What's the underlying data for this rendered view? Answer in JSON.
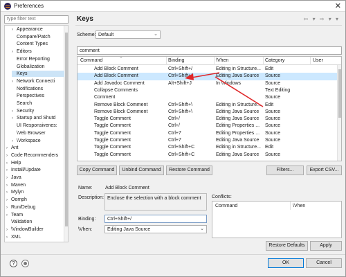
{
  "window": {
    "title": "Preferences",
    "close_glyph": "✕"
  },
  "filter": {
    "placeholder": "type filter text"
  },
  "tree": [
    {
      "label": "Appearance",
      "indent": 1,
      "arrow": "›"
    },
    {
      "label": "Compare/Patch",
      "indent": 1,
      "arrow": ""
    },
    {
      "label": "Content Types",
      "indent": 1,
      "arrow": ""
    },
    {
      "label": "Editors",
      "indent": 1,
      "arrow": "›"
    },
    {
      "label": "Error Reporting",
      "indent": 1,
      "arrow": ""
    },
    {
      "label": "Globalization",
      "indent": 1,
      "arrow": ""
    },
    {
      "label": "Keys",
      "indent": 1,
      "arrow": "",
      "selected": true
    },
    {
      "label": "Network Connecti",
      "indent": 1,
      "arrow": "›"
    },
    {
      "label": "Notifications",
      "indent": 1,
      "arrow": ""
    },
    {
      "label": "Perspectives",
      "indent": 1,
      "arrow": ""
    },
    {
      "label": "Search",
      "indent": 1,
      "arrow": ""
    },
    {
      "label": "Security",
      "indent": 1,
      "arrow": "›"
    },
    {
      "label": "Startup and Shutd",
      "indent": 1,
      "arrow": "›"
    },
    {
      "label": "UI Responsivenes:",
      "indent": 1,
      "arrow": ""
    },
    {
      "label": "\\Veb Browser",
      "indent": 1,
      "arrow": ""
    },
    {
      "label": "\\Vorkspace",
      "indent": 1,
      "arrow": "›"
    },
    {
      "label": "Ant",
      "indent": 0,
      "arrow": "›"
    },
    {
      "label": "Code Recommenders",
      "indent": 0,
      "arrow": "›"
    },
    {
      "label": "Help",
      "indent": 0,
      "arrow": "›"
    },
    {
      "label": "Install/Update",
      "indent": 0,
      "arrow": "›"
    },
    {
      "label": "Java",
      "indent": 0,
      "arrow": "›"
    },
    {
      "label": "Maven",
      "indent": 0,
      "arrow": "›"
    },
    {
      "label": "Mylyn",
      "indent": 0,
      "arrow": "›"
    },
    {
      "label": "Oomph",
      "indent": 0,
      "arrow": "›"
    },
    {
      "label": "Run/Debug",
      "indent": 0,
      "arrow": "›"
    },
    {
      "label": "Team",
      "indent": 0,
      "arrow": "›"
    },
    {
      "label": "Validation",
      "indent": 0,
      "arrow": ""
    },
    {
      "label": "\\VindowBuilder",
      "indent": 0,
      "arrow": "›"
    },
    {
      "label": "XML",
      "indent": 0,
      "arrow": "›"
    }
  ],
  "main": {
    "heading": "Keys",
    "nav_glyphs": "⇦ ▾ ⇨ ▾ ▾",
    "scheme_label": "Scheme:",
    "scheme_value": "Default",
    "search_value": "comment",
    "columns": [
      "Command",
      "Binding",
      "\\Vhen",
      "Category",
      "User"
    ],
    "rows": [
      [
        "Add Block Comment",
        "Ctrl+Shift+/",
        "Editing in Structure...",
        "Edit",
        ""
      ],
      [
        "Add Block Comment",
        "Ctrl+Shift+/",
        "Editing Java Source",
        "Source",
        ""
      ],
      [
        "Add Javadoc Comment",
        "Alt+Shift+J",
        "In \\Vindows",
        "Source",
        ""
      ],
      [
        "Collapse Comments",
        "",
        "",
        "Text Editing",
        ""
      ],
      [
        "Comment",
        "",
        "",
        "Source",
        ""
      ],
      [
        "Remove Block Comment",
        "Ctrl+Shift+\\",
        "Editing in Structure...",
        "Edit",
        ""
      ],
      [
        "Remove Block Comment",
        "Ctrl+Shift+\\",
        "Editing Java Source",
        "Source",
        ""
      ],
      [
        "Toggle Comment",
        "Ctrl+/",
        "Editing Java Source",
        "Source",
        ""
      ],
      [
        "Toggle Comment",
        "Ctrl+/",
        "Editing Properties ...",
        "Source",
        ""
      ],
      [
        "Toggle Comment",
        "Ctrl+7",
        "Editing Properties ...",
        "Source",
        ""
      ],
      [
        "Toggle Comment",
        "Ctrl+7",
        "Editing Java Source",
        "Source",
        ""
      ],
      [
        "Toggle Comment",
        "Ctrl+Shift+C",
        "Editing in Structure...",
        "Edit",
        ""
      ],
      [
        "Toggle Comment",
        "Ctrl+Shift+C",
        "Editing Java Source",
        "Source",
        ""
      ]
    ],
    "selected_row": 1,
    "buttons": {
      "copy": "Copy Command",
      "unbind": "Unbind Command",
      "restore": "Restore Command",
      "filters": "Filters...",
      "export": "Export CSV..."
    },
    "details": {
      "name_label": "Name:",
      "name_value": "Add Block Comment",
      "description_label": "Description:",
      "description_value": "Enclose the selection with a block comment",
      "binding_label": "Binding:",
      "binding_value": "Ctrl+Shift+/",
      "when_label": "\\Vhen:",
      "when_value": "Editing Java Source"
    },
    "conflicts": {
      "label": "Conflicts:",
      "columns": [
        "Command",
        "\\Vhen"
      ]
    },
    "restore_defaults": "Restore Defaults",
    "apply": "Apply"
  },
  "footer": {
    "help_glyph": "?",
    "ok": "OK",
    "cancel": "Cancel"
  },
  "colors": {
    "annotation_arrow": "#e0282a",
    "selection": "#cce8ff"
  }
}
